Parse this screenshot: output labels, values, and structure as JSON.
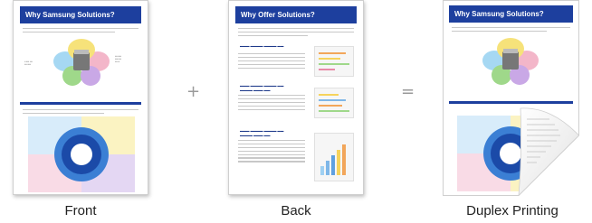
{
  "front": {
    "header_title": "Why Samsung Solutions?",
    "caption": "Front",
    "colors": {
      "header": "#1d3f9e",
      "leaf_blue": "#a6d8f3",
      "leaf_yellow": "#f6e27a",
      "leaf_green": "#9fd88a",
      "leaf_pink": "#f3b6c9"
    }
  },
  "back": {
    "header_title": "Why Offer Solutions?",
    "caption": "Back",
    "colors": {
      "header": "#1d3f9e"
    }
  },
  "duplex": {
    "header_title": "Why Samsung Solutions?",
    "caption": "Duplex Printing",
    "colors": {
      "header": "#1d3f9e",
      "curl": "#e6e6e6"
    }
  },
  "operators": {
    "plus": "+",
    "equals": "="
  }
}
